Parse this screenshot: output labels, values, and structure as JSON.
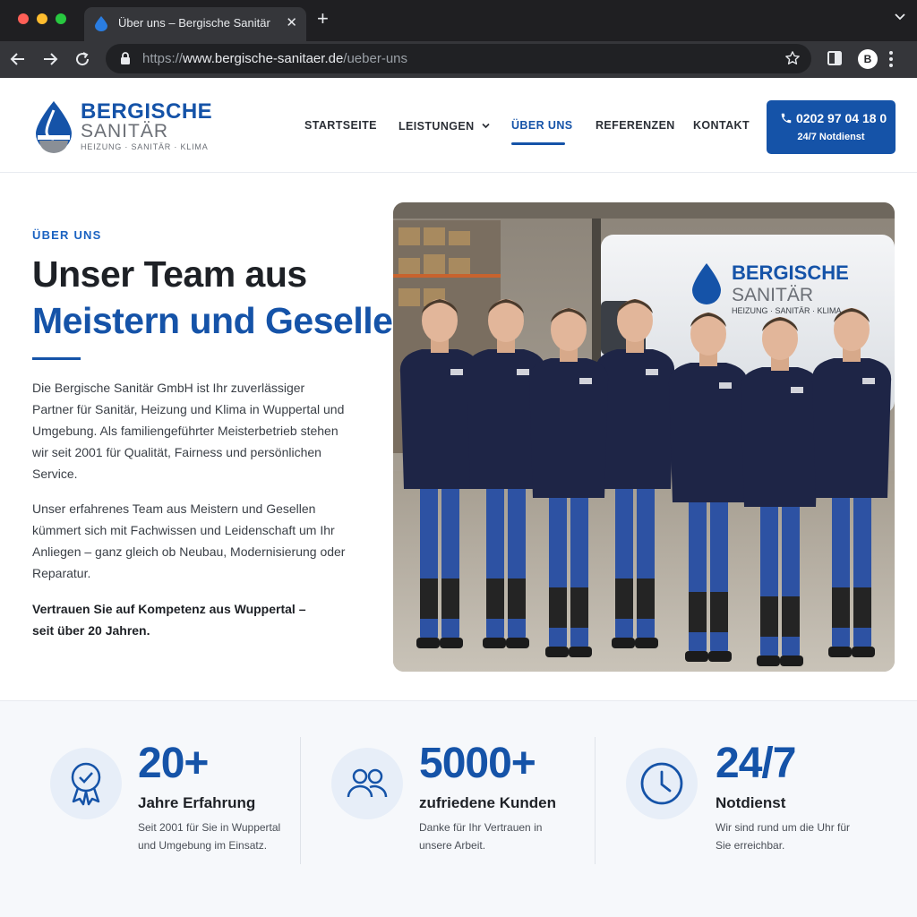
{
  "browser": {
    "tab_title": "Über uns – Bergische Sanitär",
    "url_scheme": "https://",
    "url_host": "www.bergische-sanitaer.de",
    "url_path": "/ueber-uns",
    "profile_initial": "B"
  },
  "header": {
    "logo": {
      "name_line1": "BERGISCHE",
      "name_line2": "SANITÄR",
      "tagline": "HEIZUNG · SANITÄR · KLIMA"
    },
    "nav": [
      {
        "label": "STARTSEITE"
      },
      {
        "label": "LEISTUNGEN"
      },
      {
        "label": "ÜBER UNS",
        "active": true
      },
      {
        "label": "REFERENZEN"
      },
      {
        "label": "KONTAKT"
      }
    ],
    "cta": {
      "phone": "0202 97 04 18 0",
      "subtitle": "24/7 Notdienst"
    }
  },
  "hero": {
    "eyebrow": "ÜBER UNS",
    "heading_line1": "Unser Team aus",
    "heading_line2": "Meistern und Gesellen",
    "paragraph1": "Die Bergische Sanitär GmbH ist Ihr zuverlässiger Partner für Sanitär, Heizung und Klima in Wuppertal und Umgebung. Als familiengeführter Meisterbetrieb stehen wir seit 2001 für Qualität, Fairness und persönlichen Service.",
    "paragraph2": "Unser erfahrenes Team aus Meistern und Gesellen kümmert sich mit Fachwissen und Leidenschaft um Ihr Anliegen – ganz gleich ob Neubau, Modernisierung oder Reparatur.",
    "paragraph3": "Vertrauen Sie auf Kompetenz aus Wuppertal – seit über 20 Jahren.",
    "photo": {
      "van_brand_line1": "BERGISCHE",
      "van_brand_line2": "SANITÄR",
      "van_tagline": "HEIZUNG · SANITÄR · KLIMA",
      "people_count": 7
    }
  },
  "stats": [
    {
      "icon": "award-icon",
      "value": "20+",
      "label": "Jahre Erfahrung",
      "description": "Seit 2001 für Sie in Wuppertal und Umgebung im Einsatz."
    },
    {
      "icon": "users-icon",
      "value": "5000+",
      "label": "zufriedene Kunden",
      "description": "Danke für Ihr Vertrauen in unsere Arbeit."
    },
    {
      "icon": "clock-icon",
      "value": "24/7",
      "label": "Notdienst",
      "description": "Wir sind rund um die Uhr für Sie erreichbar."
    }
  ],
  "colors": {
    "brand_blue": "#1553a8",
    "heading_dark": "#1e2126",
    "stats_bg": "#f6f8fb"
  }
}
